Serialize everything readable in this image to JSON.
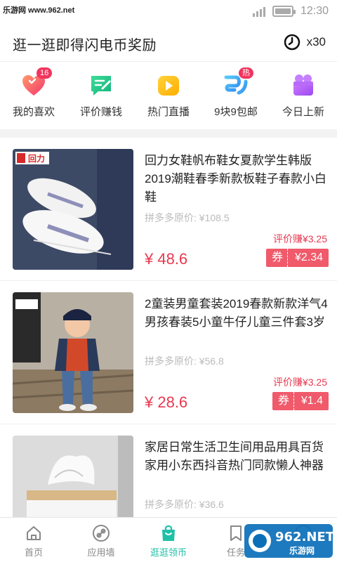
{
  "status_bar": {
    "watermark": "乐游网 www.962.net",
    "time": "12:30"
  },
  "header": {
    "title": "逛一逛即得闪电币奖励",
    "coin_count": "x30",
    "coin_icon": "clock-coin-icon"
  },
  "categories": [
    {
      "label": "我的喜欢",
      "icon": "heart-icon",
      "badge": "16"
    },
    {
      "label": "评价赚钱",
      "icon": "review-icon",
      "badge": ""
    },
    {
      "label": "热门直播",
      "icon": "live-icon",
      "badge": ""
    },
    {
      "label": "9块9包邮",
      "icon": "nine-icon",
      "badge": "热"
    },
    {
      "label": "今日上新",
      "icon": "gift-icon",
      "badge": ""
    }
  ],
  "products": [
    {
      "title": "回力女鞋帆布鞋女夏款学生韩版2019潮鞋春季新款板鞋子春款小白鞋",
      "original_price": "拼多多原价: ¥108.5",
      "rebate": "评价赚¥3.25",
      "price": "¥ 48.6",
      "coupon_label": "券",
      "coupon_value": "¥2.34",
      "brand_tag": "回力"
    },
    {
      "title": "2童装男童套装2019春款新款洋气4男孩春装5小童牛仔儿童三件套3岁",
      "original_price": "拼多多原价: ¥56.8",
      "rebate": "评价赚¥3.25",
      "price": "¥ 28.6",
      "coupon_label": "券",
      "coupon_value": "¥1.4"
    },
    {
      "title": "家居日常生活卫生间用品用具百货家用小东西抖音热门同款懒人神器",
      "original_price": "拼多多原价: ¥36.6",
      "rebate": "",
      "price": "",
      "coupon_label": "",
      "coupon_value": ""
    }
  ],
  "tabbar": [
    {
      "label": "首页",
      "icon": "home-icon",
      "active": false
    },
    {
      "label": "应用墙",
      "icon": "link-icon",
      "active": false
    },
    {
      "label": "逛逛领币",
      "icon": "shopping-bag-icon",
      "active": true
    },
    {
      "label": "任务",
      "icon": "bookmark-icon",
      "active": false
    },
    {
      "label": "",
      "icon": "profile-icon",
      "active": false
    }
  ],
  "colors": {
    "accent": "#1fc0a8",
    "price": "#e8384f",
    "coupon": "#f05a6a",
    "badge": "#f0355e"
  },
  "watermark_logo": "962.NET 乐游网"
}
